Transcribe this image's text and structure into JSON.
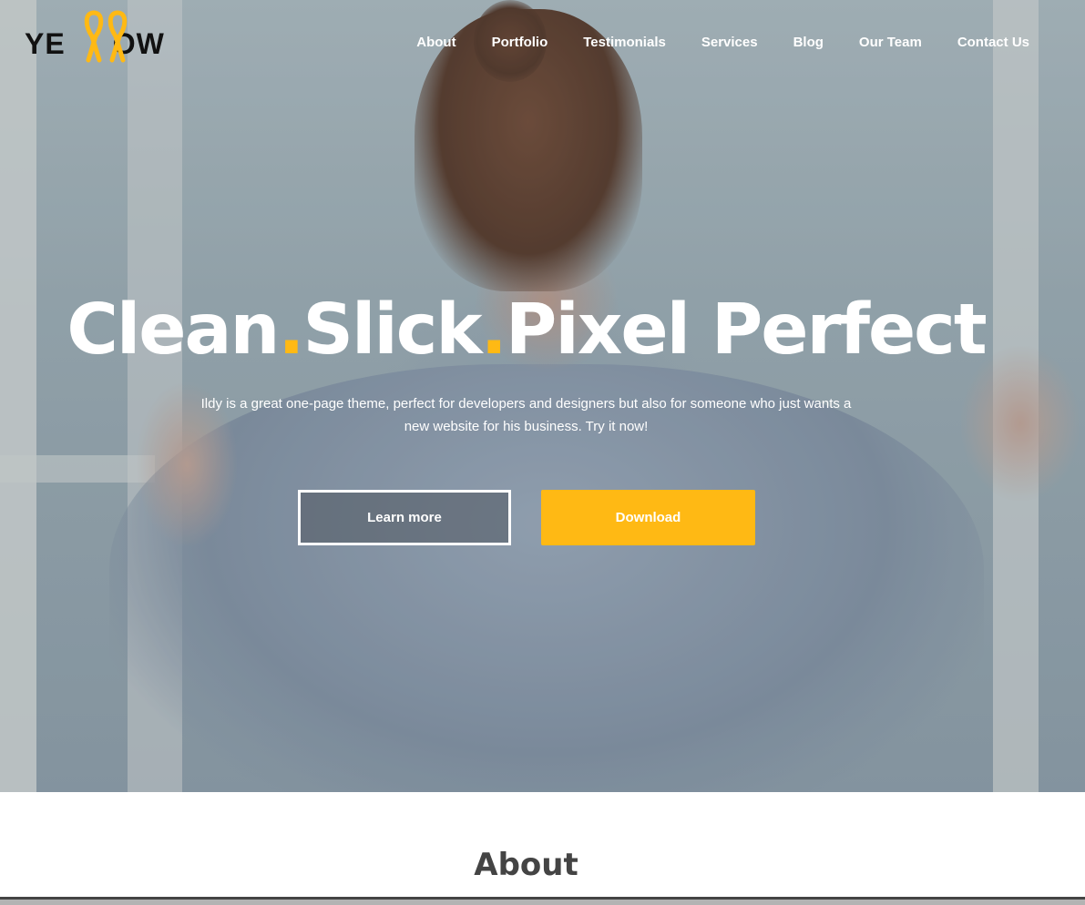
{
  "brand": {
    "logo_text_left": "YE",
    "logo_text_right": "OW",
    "accent_color": "#ffb914"
  },
  "nav": {
    "items": [
      {
        "label": "About"
      },
      {
        "label": "Portfolio"
      },
      {
        "label": "Testimonials"
      },
      {
        "label": "Services"
      },
      {
        "label": "Blog"
      },
      {
        "label": "Our Team"
      },
      {
        "label": "Contact Us"
      }
    ]
  },
  "hero": {
    "title_part1": "Clean",
    "title_dot1": ".",
    "title_part2": "Slick",
    "title_dot2": ".",
    "title_part3": "Pixel Perfect",
    "subtitle": "Ildy is a great one-page theme, perfect for developers and designers but also for someone who just wants a new website for his business. Try it now!",
    "learn_more_label": "Learn more",
    "download_label": "Download"
  },
  "about": {
    "title": "About"
  }
}
